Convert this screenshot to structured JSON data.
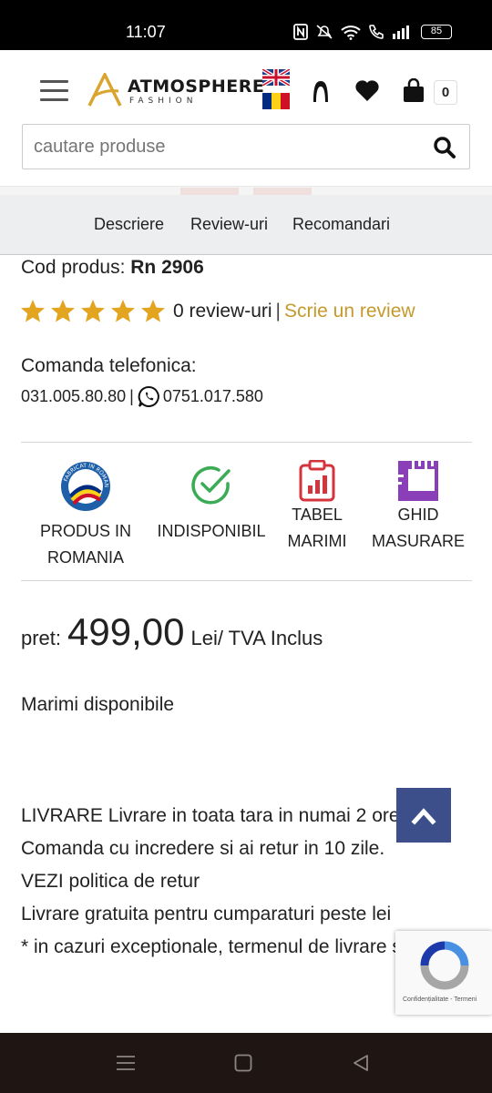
{
  "status_bar": {
    "time": "11:07",
    "battery": "85"
  },
  "header": {
    "brand_name": "ATMOSPHERE",
    "brand_sub": "FASHION",
    "cart_count": "0"
  },
  "search": {
    "placeholder": "cautare produse"
  },
  "tabs": [
    {
      "label": "Descriere"
    },
    {
      "label": "Review-uri"
    },
    {
      "label": "Recomandari"
    }
  ],
  "product": {
    "code_label": "Cod produs:",
    "code_value": "Rn 2906",
    "rating_stars": 5,
    "reviews_count": "0 review-uri",
    "separator": "|",
    "write_review": "Scrie un review",
    "phone_title": "Comanda telefonica:",
    "phone_1": "031.005.80.80",
    "phone_pipe": "|",
    "phone_2": "0751.017.580"
  },
  "badges": [
    {
      "line1": "PRODUS IN",
      "line2": "ROMANIA",
      "icon": "made-in-romania-icon",
      "seal_text": "FABRICAT IN ROMANIA"
    },
    {
      "line1": "INDISPONIBIL",
      "line2": "",
      "icon": "check-circle-icon"
    },
    {
      "line1": "TABEL",
      "line2": "MARIMI",
      "icon": "size-chart-icon"
    },
    {
      "line1": "GHID",
      "line2": "MASURARE",
      "icon": "measuring-ruler-icon"
    }
  ],
  "price": {
    "label": "pret:",
    "value": "499,00",
    "unit": "Lei/ TVA Inclus"
  },
  "sizes_label": "Marimi disponibile",
  "delivery": {
    "line1": "LIVRARE Livrare in toata tara in numai 2 ore*.",
    "line2": "Comanda cu incredere si ai retur in 10 zile.",
    "line3": "VEZI politica de retur",
    "line4": "Livrare gratuita pentru cumparaturi peste lei",
    "line5": "* in cazuri exceptionale, termenul de livrare se"
  },
  "recaptcha": {
    "links": "Confidențialitate - Termeni"
  },
  "colors": {
    "accent_gold": "#c49a2c",
    "star": "#e3a520",
    "check_green": "#3cab55",
    "chart_red": "#d4343c",
    "ruler_purple": "#8a3fb8",
    "scroll_button": "#3d4f8a"
  }
}
